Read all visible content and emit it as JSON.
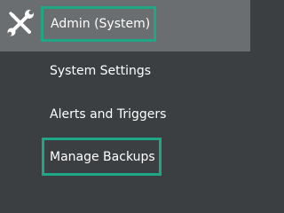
{
  "header": {
    "icon": "tools-icon",
    "label": "Admin (System)"
  },
  "menu": {
    "items": [
      {
        "label": "System Settings"
      },
      {
        "label": "Alerts and Triggers"
      },
      {
        "label": "Manage Backups"
      }
    ]
  },
  "colors": {
    "header_bg": "#6a6e71",
    "menu_bg": "#3b3f42",
    "highlight": "#1fa684",
    "text": "#ffffff"
  }
}
